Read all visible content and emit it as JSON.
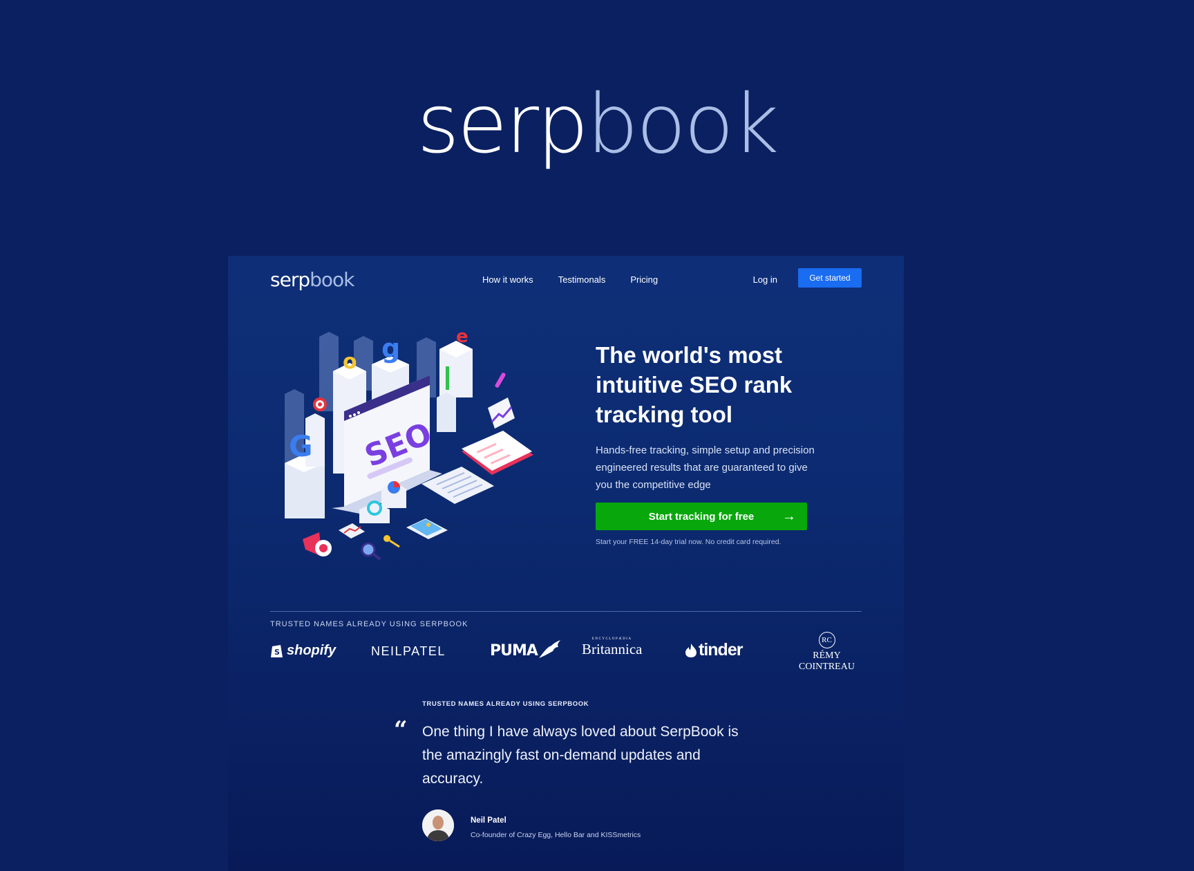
{
  "brand": {
    "part1": "serp",
    "part2": "book"
  },
  "nav": {
    "logo_part1": "serp",
    "logo_part2": "book",
    "links": [
      "How it works",
      "Testimonals",
      "Pricing"
    ],
    "login": "Log in",
    "cta": "Get started"
  },
  "illustration": {
    "screen_text": "SEO",
    "letters": [
      "G",
      "o",
      "g",
      "l",
      "e"
    ]
  },
  "hero": {
    "title": "The world's most intuitive SEO rank tracking tool",
    "subtitle": "Hands-free tracking, simple setup and precision engineered results that are guaranteed to give you the competitive edge",
    "cta": "Start tracking for free",
    "trial_note": "Start your FREE 14-day trial now. No credit card required."
  },
  "trust": {
    "heading": "TRUSTED NAMES ALREADY USING SERPBOOK",
    "logos": {
      "shopify": "shopify",
      "neilpatel": "NEILPATEL",
      "puma": "PUMA",
      "britannica_small": "ENCYCLOPÆDIA",
      "britannica": "Britannica",
      "tinder": "tinder",
      "remy_mark": "RC",
      "remy": "RÉMY COINTREAU"
    }
  },
  "testimonial": {
    "heading": "TRUSTED NAMES ALREADY USING SERPBOOK",
    "quote_mark": "“",
    "quote": "One thing I have always loved about SerpBook is the amazingly fast on-demand updates and accuracy.",
    "author": "Neil Patel",
    "role": "Co-founder of Crazy Egg, Hello Bar and KISSmetrics"
  },
  "colors": {
    "background": "#0a2060",
    "accent_blue": "#1a6cf0",
    "cta_green": "#08a80c",
    "logo_light": "#a9bde6"
  }
}
